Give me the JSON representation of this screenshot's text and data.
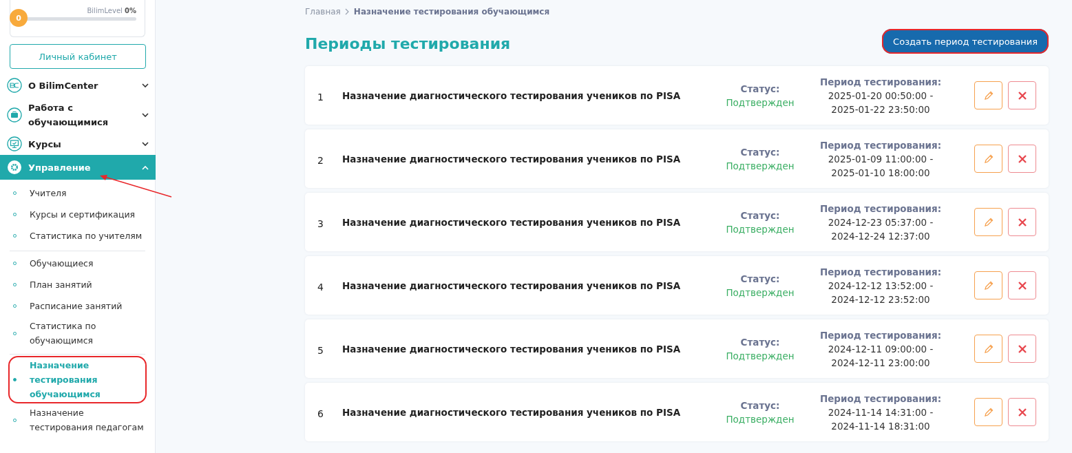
{
  "sidebar": {
    "level": {
      "label": "BilimLevel",
      "percent": "0%",
      "badge": "0",
      "level": 0
    },
    "cabinet_button": "Личный кабинет",
    "menu": [
      {
        "kind": "bc",
        "label": "О BilimCenter",
        "expanded": false
      },
      {
        "kind": "briefcase",
        "label": "Работа с обучающимися",
        "expanded": false
      },
      {
        "kind": "monitor",
        "label": "Курсы",
        "expanded": false
      },
      {
        "kind": "gear",
        "label": "Управление",
        "expanded": true,
        "annotated": true,
        "children": [
          {
            "group": [
              {
                "label": "Учителя",
                "selected": false,
                "annotated": false
              },
              {
                "label": "Курсы и сертификация",
                "selected": false,
                "annotated": false
              },
              {
                "label": "Статистика по учителям",
                "selected": false,
                "annotated": false
              }
            ]
          },
          {
            "group": [
              {
                "label": "Обучающиеся",
                "selected": false,
                "annotated": false
              },
              {
                "label": "План занятий",
                "selected": false,
                "annotated": false
              },
              {
                "label": "Расписание занятий",
                "selected": false,
                "annotated": false
              },
              {
                "label": "Статистика по обучающимся",
                "selected": false,
                "annotated": false
              }
            ]
          },
          {
            "group": [
              {
                "label": "Назначение тестирования обучающимся",
                "selected": true,
                "annotated": true
              },
              {
                "label": "Назначение тестирования педагогам",
                "selected": false,
                "annotated": false
              }
            ]
          }
        ]
      }
    ]
  },
  "breadcrumb": [
    "Главная",
    "Назначение тестирования обучающимся"
  ],
  "title": "Периоды тестирования",
  "create_button": {
    "label": "Создать период тестирования",
    "annotated": true
  },
  "rows": [
    {
      "number": "1",
      "name": "Назначение диагностического тестирования учеников по PISA",
      "status_label": "Статус:",
      "status": "Подтвержден",
      "period_label": "Период тестирования:",
      "start": "2025-01-20 00:50:00 -",
      "end": "2025-01-22 23:50:00"
    },
    {
      "number": "2",
      "name": "Назначение диагностического тестирования учеников по PISA",
      "status_label": "Статус:",
      "status": "Подтвержден",
      "period_label": "Период тестирования:",
      "start": "2025-01-09 11:00:00 -",
      "end": "2025-01-10 18:00:00"
    },
    {
      "number": "3",
      "name": "Назначение диагностического тестирования учеников по PISA",
      "status_label": "Статус:",
      "status": "Подтвержден",
      "period_label": "Период тестирования:",
      "start": "2024-12-23 05:37:00 -",
      "end": "2024-12-24 12:37:00"
    },
    {
      "number": "4",
      "name": "Назначение диагностического тестирования учеников по PISA",
      "status_label": "Статус:",
      "status": "Подтвержден",
      "period_label": "Период тестирования:",
      "start": "2024-12-12 13:52:00 -",
      "end": "2024-12-12 23:52:00"
    },
    {
      "number": "5",
      "name": "Назначение диагностического тестирования учеников по PISA",
      "status_label": "Статус:",
      "status": "Подтвержден",
      "period_label": "Период тестирования:",
      "start": "2024-12-11 09:00:00 -",
      "end": "2024-12-11 23:00:00"
    },
    {
      "number": "6",
      "name": "Назначение диагностического тестирования учеников по PISA",
      "status_label": "Статус:",
      "status": "Подтвержден",
      "period_label": "Период тестирования:",
      "start": "2024-11-14 14:31:00 -",
      "end": "2024-11-14 18:31:00"
    }
  ]
}
